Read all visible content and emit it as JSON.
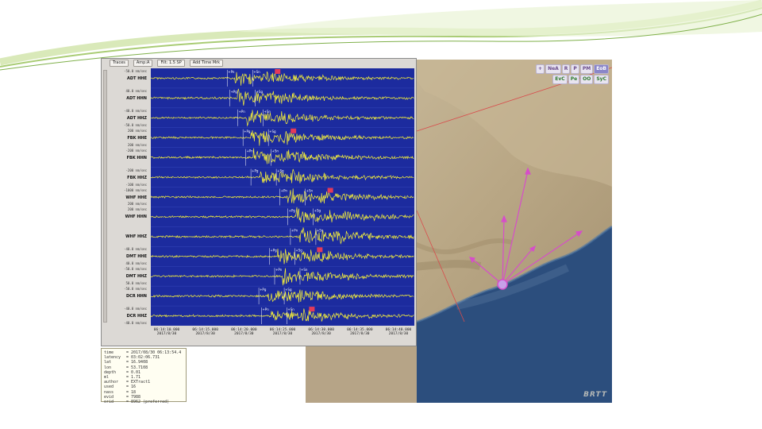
{
  "seismo_window": {
    "toolbar": {
      "traces": "Traces",
      "amp": "Amp:A",
      "filter": "Filt: 1.5 SP",
      "add_time": "Add Time Mrk"
    },
    "traces": [
      {
        "channel": "ADT HHE",
        "amp_top": "-50.0 nm/sec",
        "amp_bot": ""
      },
      {
        "channel": "ADT HHN",
        "amp_top": "40.0 nm/sec",
        "amp_bot": ""
      },
      {
        "channel": "ADT HHZ",
        "amp_top": "-40.0 nm/sec",
        "amp_bot": "-50.0 nm/sec"
      },
      {
        "channel": "FBK HHE",
        "amp_top": "200 nm/sec",
        "amp_bot": "200 nm/sec"
      },
      {
        "channel": "FBK HHN",
        "amp_top": "-200 nm/sec",
        "amp_bot": ""
      },
      {
        "channel": "FBK HHZ",
        "amp_top": "-200 nm/sec",
        "amp_bot": "-100 nm/sec"
      },
      {
        "channel": "WHF HHE",
        "amp_top": "-1000 nm/sec",
        "amp_bot": "200 nm/sec"
      },
      {
        "channel": "WHF HHN",
        "amp_top": "200 nm/sec",
        "amp_bot": ""
      },
      {
        "channel": "WHF HHZ",
        "amp_top": "",
        "amp_bot": ""
      },
      {
        "channel": "DMT HHE",
        "amp_top": "-40.0 nm/sec",
        "amp_bot": "40.0 nm/sec"
      },
      {
        "channel": "DMT HHZ",
        "amp_top": "-50.0 nm/sec",
        "amp_bot": "50.0 nm/sec"
      },
      {
        "channel": "DCR HHN",
        "amp_top": "-50.0 nm/sec",
        "amp_bot": ""
      },
      {
        "channel": "DCR HHZ",
        "amp_top": "-40.0 nm/sec",
        "amp_bot": "-40.0 nm/sec"
      }
    ],
    "time_ticks": [
      {
        "time": "06:14:10.000",
        "date": "2017/8/30"
      },
      {
        "time": "06:14:15.000",
        "date": "2017/8/30"
      },
      {
        "time": "06:14:20.000",
        "date": "2017/8/30"
      },
      {
        "time": "06:14:25.000",
        "date": "2017/8/30"
      },
      {
        "time": "06:14:30.000",
        "date": "2017/8/30"
      },
      {
        "time": "06:14:35.000",
        "date": "2017/8/30"
      },
      {
        "time": "06:14:40.000",
        "date": "2017/8/30"
      }
    ],
    "pick_labels": [
      "+Pn",
      "+Sn",
      "+Pg",
      "+Sg"
    ]
  },
  "event_info": [
    {
      "key": "time",
      "value": "= 2017/08/30 06:13:54.4"
    },
    {
      "key": "latency",
      "value": "= 03:02:06.731"
    },
    {
      "key": "lat",
      "value": "= 16.9408"
    },
    {
      "key": "lon",
      "value": "= 53.7108"
    },
    {
      "key": "depth",
      "value": "= 0.01"
    },
    {
      "key": "ml",
      "value": "= 1.71"
    },
    {
      "key": "author",
      "value": "= EXTract1"
    },
    {
      "key": "used",
      "value": "= 16"
    },
    {
      "key": "nass",
      "value": "= 18"
    },
    {
      "key": "evid",
      "value": "= 7988"
    },
    {
      "key": "orid",
      "value": "= 8962 (preferred)"
    }
  ],
  "map": {
    "toolbar": [
      "+",
      "NeA",
      "R",
      "P",
      "PM",
      "EoB",
      "EvC",
      "Pe",
      "OO",
      "SyC"
    ],
    "credit": "BRTT",
    "colors": {
      "ray": "#d64ec9",
      "event": "#c7a0e8",
      "land": "#b8a68a",
      "sea": "#2c4e7d",
      "trace_bg": "#1c2b9e",
      "trace": "#f6f03a"
    }
  }
}
